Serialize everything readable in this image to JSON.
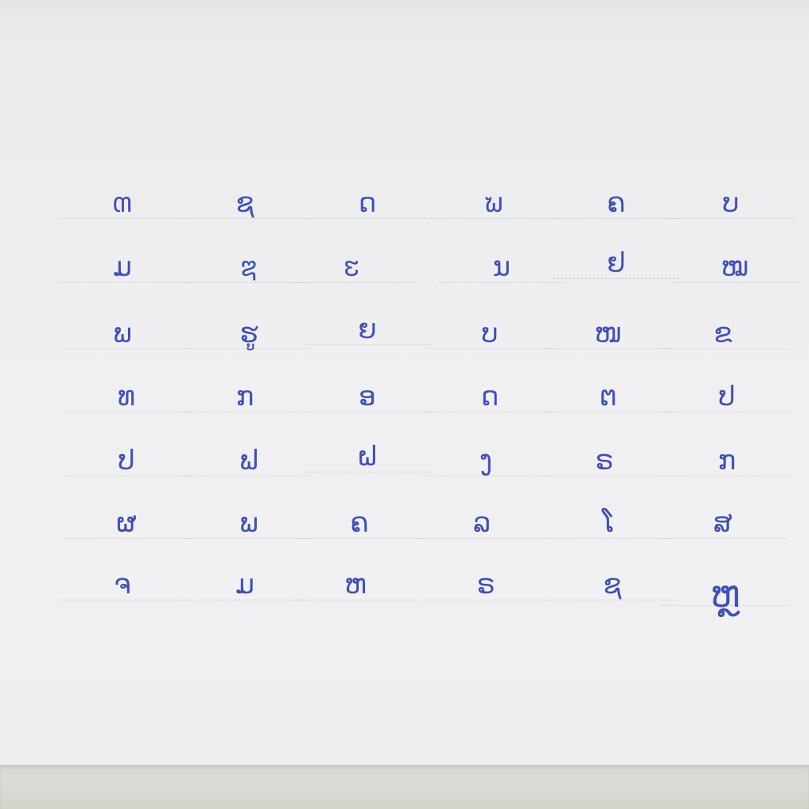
{
  "photo": {
    "subject": "handwritten letters on paper",
    "ink_color": "#3f4fb8",
    "paper_color": "#eeeef0",
    "grid": {
      "rows": 7,
      "columns": 6
    },
    "rows": [
      [
        "ຓ",
        "ຊ",
        "ດ",
        "ຆ",
        "ຄ",
        "ບ"
      ],
      [
        "ມ",
        "ຌ",
        "ຬ",
        "ນ",
        "ຢ",
        "ໝ"
      ],
      [
        "ພ",
        "ຮູ",
        "ຍ",
        "ບ",
        "ໜ",
        "ຂ"
      ],
      [
        "ທ",
        "ກ",
        "ອ",
        "ດ",
        "ຕ",
        "ປ"
      ],
      [
        "ປ",
        "ຟ",
        "ຝ",
        "ງ",
        "ຣ",
        "ກ"
      ],
      [
        "ຜ",
        "ພ",
        "ຄ",
        "ລ",
        "ໂ",
        "ສ"
      ],
      [
        "ຈ",
        "ມ",
        "ຫ",
        "ຣ",
        "ຊ",
        "ຫຼ"
      ]
    ]
  }
}
